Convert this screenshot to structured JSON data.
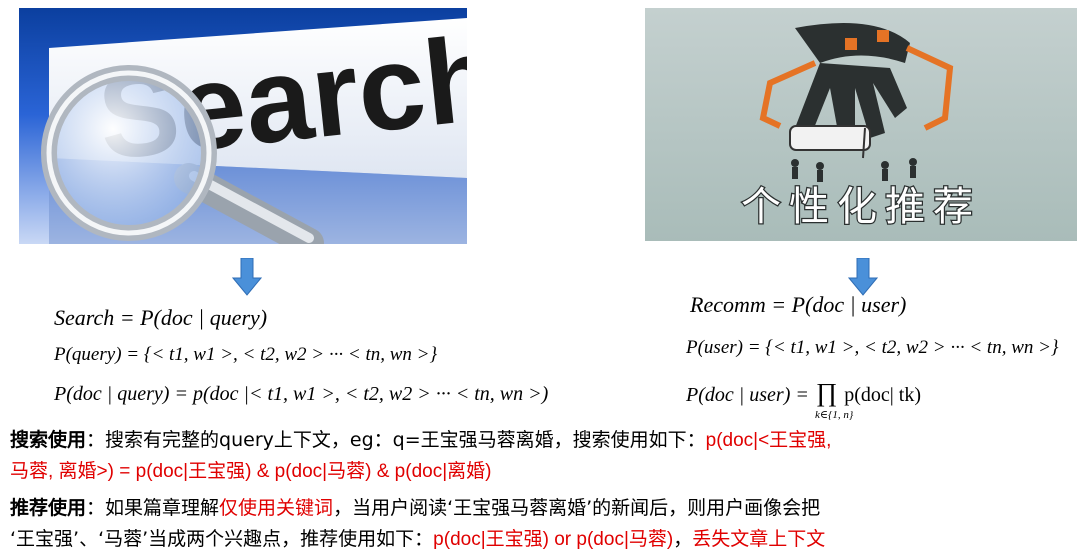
{
  "images": {
    "search": {
      "word": "Search"
    },
    "recommend": {
      "caption": "个性化推荐"
    }
  },
  "formulas": {
    "search": {
      "line1": "Search = P(doc | query)",
      "line2": "P(query) = {< t1, w1 >, < t2, w2 > ··· < tn, wn >}",
      "line3": "P(doc | query) = p(doc |< t1, w1 >, < t2, w2 > ··· < tn, wn >)"
    },
    "recommend": {
      "line1": "Recomm = P(doc | user)",
      "line2": "P(user) = {< t1, w1 >, < t2, w2 > ··· < tn, wn >}",
      "line3_lhs": "P(doc | user) =",
      "line3_op": "∏",
      "line3_rhs": "p(doc| tk)",
      "line3_sub": "k∈{1, n}"
    }
  },
  "para1": {
    "label": "搜索使用",
    "colon": "：",
    "text": "搜索有完整的query上下文，eg：q=王宝强马蓉离婚，搜索使用如下：",
    "red_1": "p(doc|<王宝强,",
    "red_2": "马蓉, 离婚>) = p(doc|王宝强)  &  p(doc|马蓉)  &  p(doc|离婚)"
  },
  "para2": {
    "label": "推荐使用",
    "colon": "：",
    "text_a": "如果篇章理解",
    "red_a": "仅使用关键词",
    "text_b": "，当用户阅读‘王宝强马蓉离婚’的新闻后，则用户画像会把",
    "text_c": "‘王宝强’、‘马蓉’当成两个兴趣点，推荐使用如下：",
    "red_b": "p(doc|王宝强)  or  p(doc|马蓉)",
    "text_d": "，",
    "red_c": "丢失文章上下文"
  },
  "colors": {
    "accent_red": "#e00000",
    "arrow_blue": "#4a90d9"
  }
}
